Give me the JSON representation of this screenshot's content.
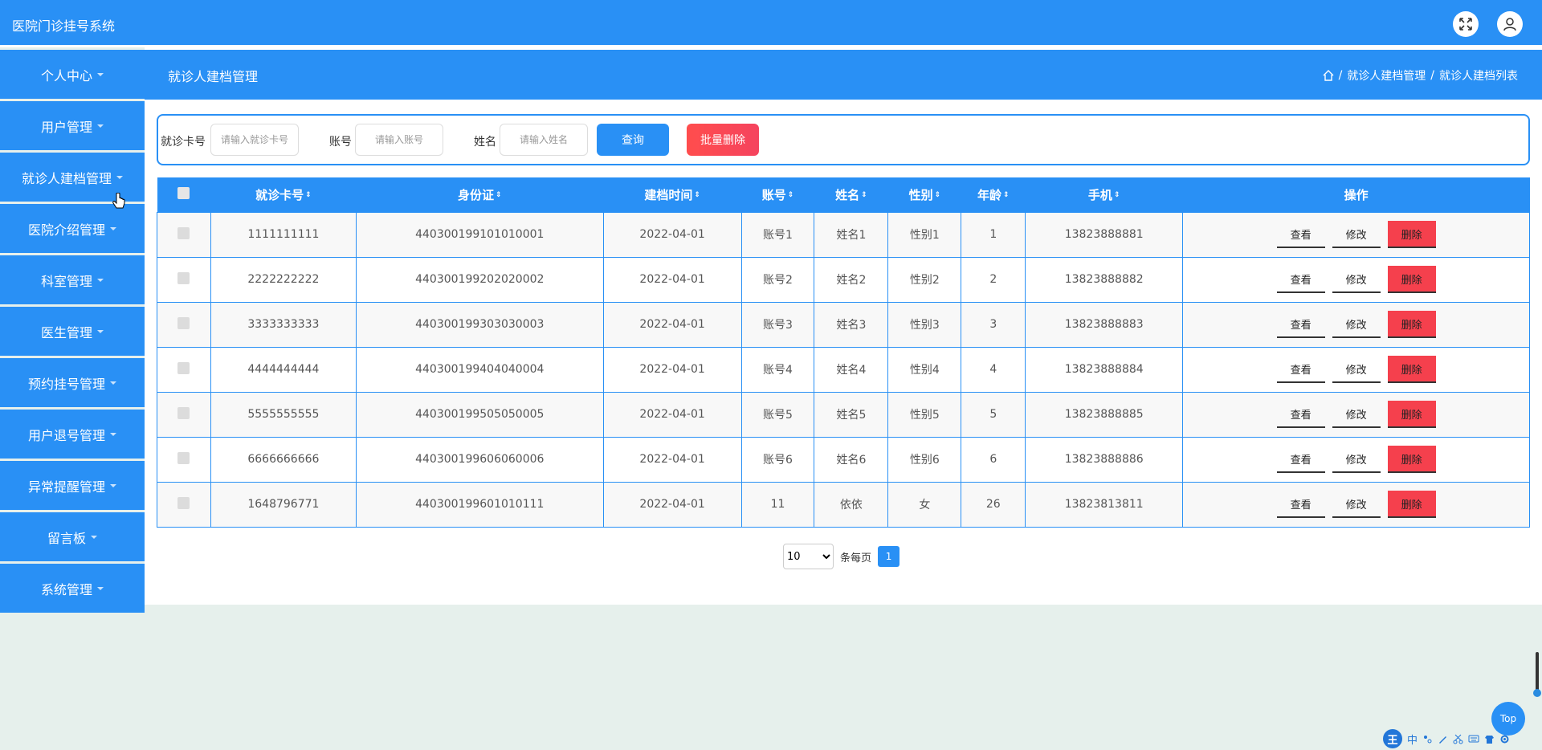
{
  "app": {
    "title": "医院门诊挂号系统"
  },
  "topbar_icons": [
    "fullscreen-icon",
    "user-icon"
  ],
  "sidebar": {
    "items": [
      {
        "label": "个人中心"
      },
      {
        "label": "用户管理"
      },
      {
        "label": "就诊人建档管理"
      },
      {
        "label": "医院介绍管理"
      },
      {
        "label": "科室管理"
      },
      {
        "label": "医生管理"
      },
      {
        "label": "预约挂号管理"
      },
      {
        "label": "用户退号管理"
      },
      {
        "label": "异常提醒管理"
      },
      {
        "label": "留言板"
      },
      {
        "label": "系统管理"
      }
    ]
  },
  "header": {
    "page_title": "就诊人建档管理",
    "breadcrumb": [
      "就诊人建档管理",
      "就诊人建档列表"
    ],
    "breadcrumb_sep": "/"
  },
  "search": {
    "card_label": "就诊卡号",
    "card_placeholder": "请输入就诊卡号",
    "account_label": "账号",
    "account_placeholder": "请输入账号",
    "name_label": "姓名",
    "name_placeholder": "请输入姓名",
    "query_button": "查询",
    "batch_delete_button": "批量删除"
  },
  "table": {
    "headers": [
      "就诊卡号",
      "身份证",
      "建档时间",
      "账号",
      "姓名",
      "性别",
      "年龄",
      "手机",
      "操作"
    ],
    "sort_icon": "⇕",
    "actions": {
      "view": "查看",
      "edit": "修改",
      "delete": "删除"
    },
    "rows": [
      [
        "1111111111",
        "440300199101010001",
        "2022-04-01",
        "账号1",
        "姓名1",
        "性别1",
        "1",
        "13823888881"
      ],
      [
        "2222222222",
        "440300199202020002",
        "2022-04-01",
        "账号2",
        "姓名2",
        "性别2",
        "2",
        "13823888882"
      ],
      [
        "3333333333",
        "440300199303030003",
        "2022-04-01",
        "账号3",
        "姓名3",
        "性别3",
        "3",
        "13823888883"
      ],
      [
        "4444444444",
        "440300199404040004",
        "2022-04-01",
        "账号4",
        "姓名4",
        "性别4",
        "4",
        "13823888884"
      ],
      [
        "5555555555",
        "440300199505050005",
        "2022-04-01",
        "账号5",
        "姓名5",
        "性别5",
        "5",
        "13823888885"
      ],
      [
        "6666666666",
        "440300199606060006",
        "2022-04-01",
        "账号6",
        "姓名6",
        "性别6",
        "6",
        "13823888886"
      ],
      [
        "1648796771",
        "440300199601010111",
        "2022-04-01",
        "11",
        "依依",
        "女",
        "26",
        "13823813811"
      ]
    ]
  },
  "pagination": {
    "page_size": "10",
    "page_size_options": [
      "10"
    ],
    "per_page_label": "条每页",
    "current_page": "1"
  },
  "back_to_top": "Top",
  "ime": {
    "logo": "王",
    "mode": "中"
  },
  "colors": {
    "primary": "#2990f5",
    "danger": "#f5404d",
    "background": "#e6f0ec"
  }
}
